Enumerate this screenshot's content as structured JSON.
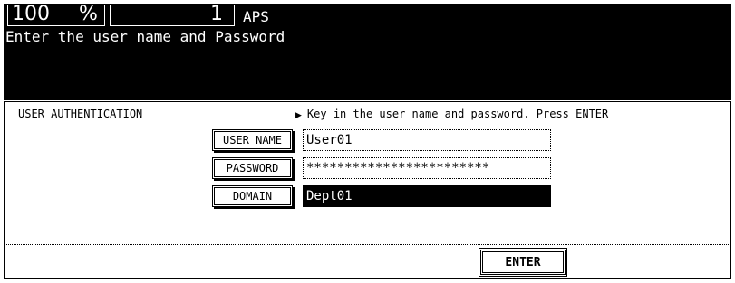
{
  "header": {
    "zoom_value": "100",
    "zoom_unit": "%",
    "copy_quantity": "1",
    "paper_mode": "APS",
    "message": "Enter the user name and Password"
  },
  "auth": {
    "title": "USER AUTHENTICATION",
    "instruction": "Key in the user name and password. Press ENTER",
    "fields": [
      {
        "label": "USER NAME",
        "value": "User01",
        "selected": false
      },
      {
        "label": "PASSWORD",
        "value": "************************",
        "selected": false
      },
      {
        "label": "DOMAIN",
        "value": "Dept01",
        "selected": true
      }
    ],
    "enter_label": "ENTER"
  }
}
